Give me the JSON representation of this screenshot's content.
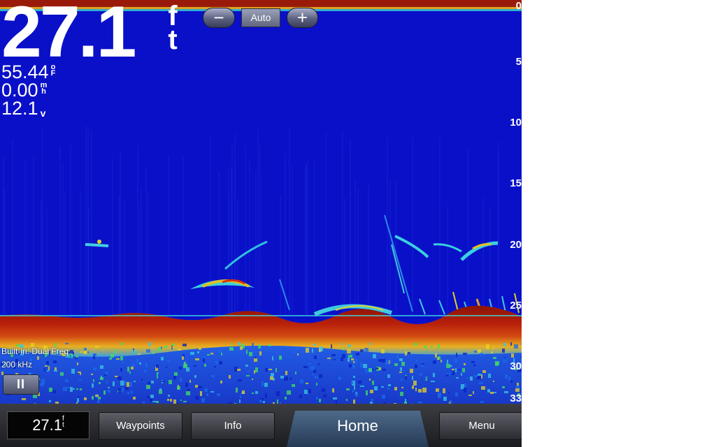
{
  "sonar": {
    "depth_value": "27.1",
    "depth_unit": "f\nt",
    "temperature": "55.44",
    "temperature_unit": "o\nF",
    "speed": "0.00",
    "speed_unit": "m\nh",
    "voltage": "12.1",
    "voltage_unit": "v",
    "transducer": "Built-in: Dual Freq",
    "frequency": "200 kHz",
    "pause_label": "II"
  },
  "zoom": {
    "minus": "−",
    "auto": "Auto",
    "plus": "+"
  },
  "depth_scale": [
    "0",
    "5",
    "10",
    "15",
    "20",
    "25",
    "30",
    "33"
  ],
  "bottom_bar": {
    "depth_value": "27.1",
    "depth_unit": "f\nt",
    "waypoints": "Waypoints",
    "info": "Info",
    "home": "Home",
    "menu": "Menu"
  },
  "colors": {
    "water": "#0a10c8",
    "bottom_return": "#b01a08",
    "bottom_strong": "#e8d020",
    "clutter": "#1a6ae8"
  }
}
